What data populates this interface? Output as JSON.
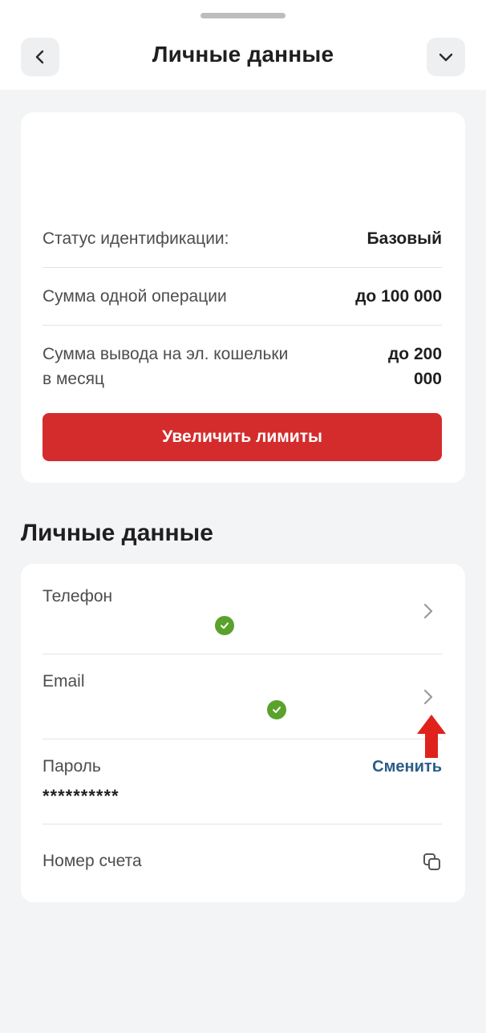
{
  "header": {
    "title": "Личные данные",
    "back_icon": "chevron-left-icon",
    "collapse_icon": "chevron-down-icon"
  },
  "limits": {
    "rows": [
      {
        "label": "Статус идентификации:",
        "value": "Базовый"
      },
      {
        "label": "Сумма одной операции",
        "value": "до 100 000"
      },
      {
        "label_line1": "Сумма вывода на эл. кошельки",
        "label_line2": "в месяц",
        "value_line1": "до 200",
        "value_line2": "000"
      }
    ],
    "button_label": "Увеличить лимиты"
  },
  "personal": {
    "section_title": "Личные данные",
    "phone_label": "Телефон",
    "email_label": "Email",
    "password_label": "Пароль",
    "password_value": "**********",
    "change_label": "Сменить",
    "account_label": "Номер счета"
  },
  "colors": {
    "accent_red": "#d42c2c",
    "link_blue": "#2b5c8a",
    "verified_green": "#5aa22b",
    "background": "#f3f4f6"
  }
}
